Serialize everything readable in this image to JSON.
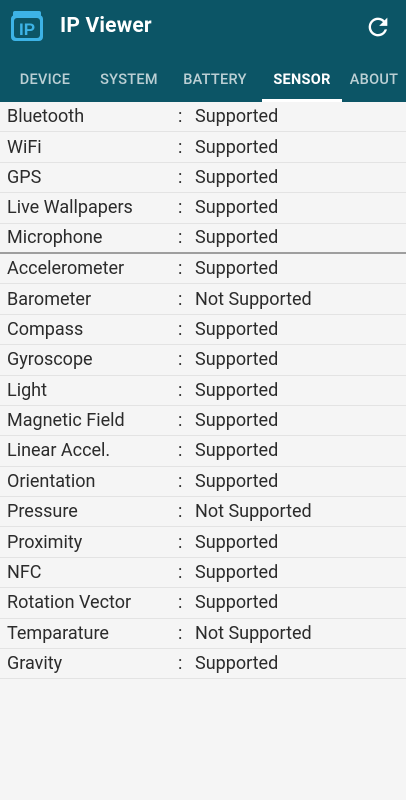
{
  "app": {
    "title": "IP Viewer",
    "icon_text": "IP"
  },
  "tabs": [
    {
      "label": "DEVICE",
      "active": false
    },
    {
      "label": "SYSTEM",
      "active": false
    },
    {
      "label": "BATTERY",
      "active": false
    },
    {
      "label": "SENSOR",
      "active": true
    },
    {
      "label": "ABOUT",
      "active": false
    }
  ],
  "separator": ":",
  "features": [
    {
      "name": "Bluetooth",
      "value": "Supported"
    },
    {
      "name": "WiFi",
      "value": "Supported"
    },
    {
      "name": "GPS",
      "value": "Supported"
    },
    {
      "name": "Live Wallpapers",
      "value": "Supported"
    },
    {
      "name": "Microphone",
      "value": "Supported"
    }
  ],
  "sensors": [
    {
      "name": "Accelerometer",
      "value": "Supported"
    },
    {
      "name": "Barometer",
      "value": "Not Supported"
    },
    {
      "name": "Compass",
      "value": "Supported"
    },
    {
      "name": "Gyroscope",
      "value": "Supported"
    },
    {
      "name": "Light",
      "value": "Supported"
    },
    {
      "name": "Magnetic Field",
      "value": "Supported"
    },
    {
      "name": "Linear Accel.",
      "value": "Supported"
    },
    {
      "name": "Orientation",
      "value": "Supported"
    },
    {
      "name": "Pressure",
      "value": "Not Supported"
    },
    {
      "name": "Proximity",
      "value": "Supported"
    },
    {
      "name": "NFC",
      "value": "Supported"
    },
    {
      "name": "Rotation Vector",
      "value": "Supported"
    },
    {
      "name": "Temparature",
      "value": "Not Supported"
    },
    {
      "name": "Gravity",
      "value": "Supported"
    }
  ],
  "colors": {
    "appbar": "#0c5566",
    "icon_accent": "#3db3e6"
  }
}
